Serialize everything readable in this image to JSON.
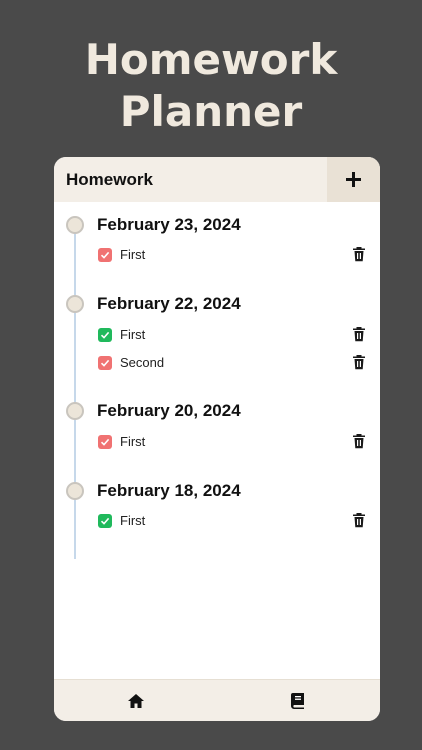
{
  "hero": {
    "line1": "Homework",
    "line2": "Planner"
  },
  "card": {
    "title": "Homework",
    "add_icon": "plus-icon"
  },
  "days": [
    {
      "date": "February 23, 2024",
      "tasks": [
        {
          "label": "First",
          "done": false
        }
      ]
    },
    {
      "date": "February 22, 2024",
      "tasks": [
        {
          "label": "First",
          "done": true
        },
        {
          "label": "Second",
          "done": false
        }
      ]
    },
    {
      "date": "February 20, 2024",
      "tasks": [
        {
          "label": "First",
          "done": false
        }
      ]
    },
    {
      "date": "February 18, 2024",
      "tasks": [
        {
          "label": "First",
          "done": true
        }
      ]
    }
  ],
  "tabs": [
    {
      "icon": "home-icon"
    },
    {
      "icon": "book-icon"
    }
  ],
  "colors": {
    "background": "#4a4a4a",
    "hero_text": "#f0e9de",
    "done": "#20b95c",
    "undone": "#f07272",
    "timeline": "#c6d8ea"
  }
}
